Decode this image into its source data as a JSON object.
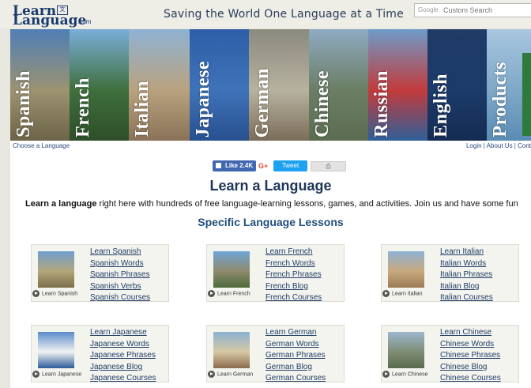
{
  "header": {
    "logo_line1": "Learn",
    "logo_line2": "Language",
    "logo_com": ".com",
    "tagline": "Saving the World One Language at a Time",
    "search_brand": "Google",
    "search_placeholder": "Custom Search"
  },
  "banner": [
    {
      "label": "Spanish",
      "colors": [
        "#4f7fb6",
        "#9c9371",
        "#6d6449"
      ]
    },
    {
      "label": "French",
      "colors": [
        "#7aaed9",
        "#3f6f3c",
        "#2e4e2a"
      ]
    },
    {
      "label": "Italian",
      "colors": [
        "#8fb2d4",
        "#b9a27e",
        "#8a7258"
      ]
    },
    {
      "label": "Japanese",
      "colors": [
        "#2d5ea8",
        "#3f73b8",
        "#28508f"
      ]
    },
    {
      "label": "German",
      "colors": [
        "#8a8a7e",
        "#b7b2a0",
        "#7b6d58"
      ]
    },
    {
      "label": "Chinese",
      "colors": [
        "#8faac2",
        "#6b7e64",
        "#5b6c51"
      ]
    },
    {
      "label": "Russian",
      "colors": [
        "#6d9bc9",
        "#c23b3b",
        "#2f5f99"
      ]
    },
    {
      "label": "English",
      "colors": [
        "#1f3b66",
        "#1c3b6a",
        "#142c52"
      ]
    },
    {
      "label": "Products",
      "colors": [
        "#a8c6df",
        "#7ea8c8",
        "#5a8cb4"
      ]
    }
  ],
  "subnav": {
    "left": "Choose a Language",
    "login": "Login",
    "about": "About Us",
    "contact": "Cont"
  },
  "social": {
    "fb": "Like 2.4K",
    "gplus": "G+",
    "tweet": "Tweet",
    "print": "⎙"
  },
  "main": {
    "title": "Learn a Language",
    "intro_bold": "Learn a language",
    "intro_rest": " right here with hundreds of free language-learning lessons, games, and activities. Join us and have some fun",
    "subtitle": "Specific Language Lessons"
  },
  "cards": [
    {
      "play": "Learn Spanish",
      "links": [
        "Learn Spanish",
        "Spanish Words",
        "Spanish Phrases",
        "Spanish Verbs",
        "Spanish Courses"
      ],
      "colors": [
        "#6f9fd0",
        "#b4a67a",
        "#7b6f4c"
      ]
    },
    {
      "play": "Learn French",
      "links": [
        "Learn French",
        "French Words",
        "French Phrases",
        "French Blog",
        "French Courses"
      ],
      "colors": [
        "#6ea5d6",
        "#8f8a6c",
        "#4d6a3a"
      ]
    },
    {
      "play": "Learn Italian",
      "links": [
        "Learn Italian",
        "Italian Words",
        "Italian Phrases",
        "Italian Blog",
        "Italian Courses"
      ],
      "colors": [
        "#8fb2d4",
        "#c9a97d",
        "#9a7b58"
      ]
    },
    {
      "play": "Learn Japanese",
      "links": [
        "Learn Japanese",
        "Japanese Words",
        "Japanese Phrases",
        "Japanese Blog",
        "Japanese Courses"
      ],
      "colors": [
        "#5b8ccc",
        "#f2f2f2",
        "#2d5c9a"
      ]
    },
    {
      "play": "Learn German",
      "links": [
        "Learn German",
        "German Words",
        "German Phrases",
        "German Blog",
        "German Courses"
      ],
      "colors": [
        "#8bb0d2",
        "#d7c8a3",
        "#8a6b4e"
      ]
    },
    {
      "play": "Learn Chinese",
      "links": [
        "Learn Chinese",
        "Chinese Words",
        "Chinese Phrases",
        "Chinese Blog",
        "Chinese Courses"
      ],
      "colors": [
        "#9db7cf",
        "#7e8c74",
        "#5a6b4c"
      ]
    }
  ]
}
